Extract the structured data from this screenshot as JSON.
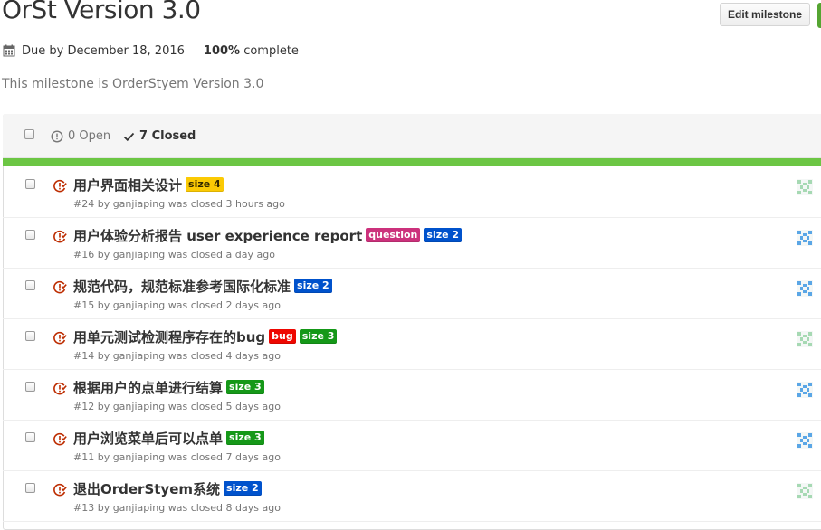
{
  "milestone": {
    "title": "OrSt Version 3.0",
    "edit_label": "Edit milestone",
    "due": "Due by December 18, 2016",
    "percent": "100%",
    "percent_suffix": " complete",
    "description": "This milestone is OrderStyem Version 3.0",
    "progress_fraction": 1.0
  },
  "tabs": {
    "open": "0 Open",
    "closed": "7 Closed"
  },
  "colors": {
    "progress": "#6cc644",
    "closed_icon": "#bd2c00",
    "size4": "#fbca04",
    "size2": "#0052cc",
    "size3": "#159818",
    "question": "#cc317c",
    "bug": "#ee0701"
  },
  "issues": [
    {
      "title": "用户界面相关设计",
      "labels": [
        {
          "text": "size 4",
          "bg": "#fbca04",
          "fg": "#332900"
        }
      ],
      "meta": "#24 by ganjiaping was closed 3 hours ago",
      "avatar": "green"
    },
    {
      "title": "用户体验分析报告 user experience report",
      "labels": [
        {
          "text": "question",
          "bg": "#cc317c",
          "fg": "#ffffff"
        },
        {
          "text": "size 2",
          "bg": "#0052cc",
          "fg": "#ffffff"
        }
      ],
      "meta": "#16 by ganjiaping was closed a day ago",
      "avatar": "blue"
    },
    {
      "title": "规范代码，规范标准参考国际化标准",
      "labels": [
        {
          "text": "size 2",
          "bg": "#0052cc",
          "fg": "#ffffff"
        }
      ],
      "meta": "#15 by ganjiaping was closed 2 days ago",
      "avatar": "blue"
    },
    {
      "title": "用单元测试检测程序存在的bug",
      "labels": [
        {
          "text": "bug",
          "bg": "#ee0701",
          "fg": "#ffffff"
        },
        {
          "text": "size 3",
          "bg": "#159818",
          "fg": "#ffffff"
        }
      ],
      "meta": "#14 by ganjiaping was closed 4 days ago",
      "avatar": "green"
    },
    {
      "title": "根据用户的点单进行结算",
      "labels": [
        {
          "text": "size 3",
          "bg": "#159818",
          "fg": "#ffffff"
        }
      ],
      "meta": "#12 by ganjiaping was closed 5 days ago",
      "avatar": "blue"
    },
    {
      "title": "用户浏览菜单后可以点单",
      "labels": [
        {
          "text": "size 3",
          "bg": "#159818",
          "fg": "#ffffff"
        }
      ],
      "meta": "#11 by ganjiaping was closed 7 days ago",
      "avatar": "blue"
    },
    {
      "title": "退出OrderStyem系统",
      "labels": [
        {
          "text": "size 2",
          "bg": "#0052cc",
          "fg": "#ffffff"
        }
      ],
      "meta": "#13 by ganjiaping was closed 8 days ago",
      "avatar": "green"
    }
  ]
}
